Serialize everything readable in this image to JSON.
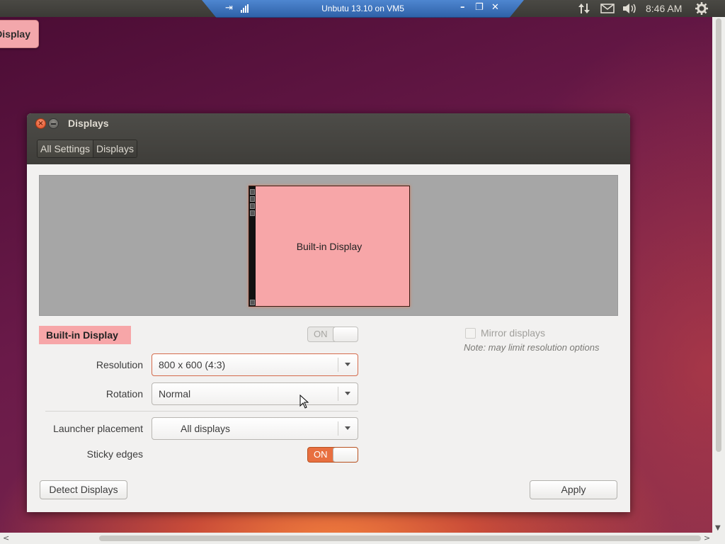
{
  "panel": {
    "vm_title": "Unbutu 13.10 on VM5",
    "clock": "8:46 AM",
    "tray_icons": [
      "network-arrows-icon",
      "mail-icon",
      "volume-icon",
      "power-gear-icon"
    ],
    "vm_controls": [
      "pin-icon",
      "signal-icon",
      "minimize-icon",
      "restore-icon",
      "close-icon"
    ]
  },
  "desktop": {
    "launcher_item_label": "Display"
  },
  "window": {
    "title": "Displays",
    "breadcrumbs": [
      "All Settings",
      "Displays"
    ],
    "preview": {
      "monitor_label": "Built-in Display"
    },
    "display_name": "Built-in Display",
    "display_toggle": {
      "label": "ON",
      "state": "on"
    },
    "mirror": {
      "label": "Mirror displays",
      "checked": false,
      "note": "Note: may limit resolution options"
    },
    "resolution": {
      "label": "Resolution",
      "value": "800 x 600 (4:3)"
    },
    "rotation": {
      "label": "Rotation",
      "value": "Normal"
    },
    "launcher_placement": {
      "label": "Launcher placement",
      "value": "All displays"
    },
    "sticky_edges": {
      "label": "Sticky edges",
      "toggle_label": "ON",
      "state": "on"
    },
    "buttons": {
      "detect": "Detect Displays",
      "apply": "Apply"
    }
  },
  "colors": {
    "accent_orange": "#e86f40",
    "display_pink": "#f7a6a8",
    "titlebar_dark": "#3f3e3a",
    "vm_blue": "#2f62a8"
  }
}
